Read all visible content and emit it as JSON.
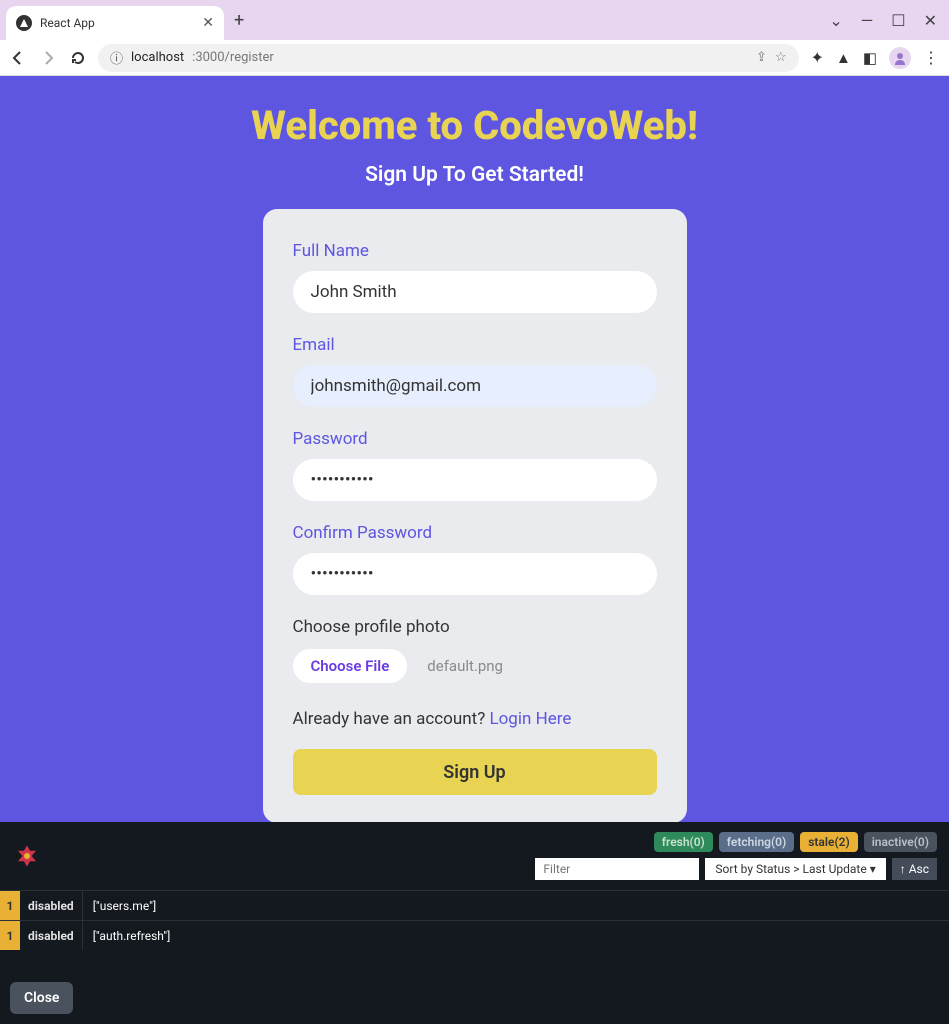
{
  "browser": {
    "tab_title": "React App",
    "url_host": "localhost",
    "url_path": ":3000/register"
  },
  "page": {
    "title": "Welcome to CodevoWeb!",
    "subtitle": "Sign Up To Get Started!"
  },
  "form": {
    "full_name_label": "Full Name",
    "full_name_value": "John Smith",
    "email_label": "Email",
    "email_value": "johnsmith@gmail.com",
    "password_label": "Password",
    "password_value": "•••••••••••",
    "confirm_label": "Confirm Password",
    "confirm_value": "•••••••••••",
    "photo_hint": "Choose profile photo",
    "choose_file_label": "Choose File",
    "file_name": "default.png",
    "already_text": "Already have an account? ",
    "login_link": "Login Here",
    "submit_label": "Sign Up"
  },
  "devtools": {
    "badges": {
      "fresh": "fresh(0)",
      "fetching": "fetching(0)",
      "stale": "stale(2)",
      "inactive": "inactive(0)"
    },
    "filter_placeholder": "Filter",
    "sort_label": "Sort by Status > Last Update ▾",
    "asc_label": "↑ Asc",
    "queries": [
      {
        "count": "1",
        "status": "disabled",
        "key": "[\"users.me\"]"
      },
      {
        "count": "1",
        "status": "disabled",
        "key": "[\"auth.refresh\"]"
      }
    ],
    "close_label": "Close"
  }
}
